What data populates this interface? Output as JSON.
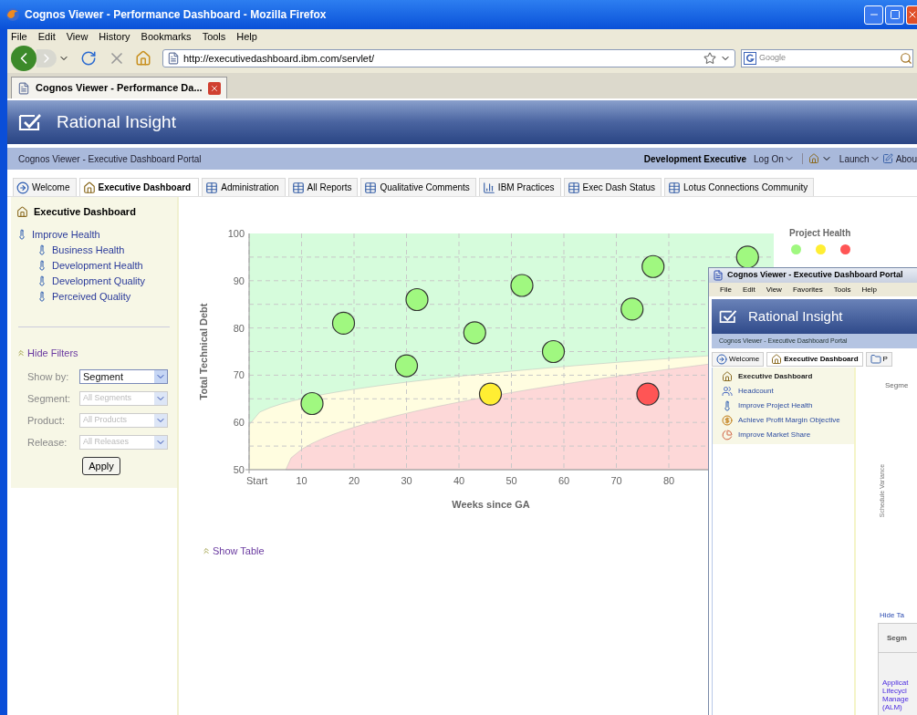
{
  "window": {
    "title": "Cognos Viewer - Performance Dashboard - Mozilla Firefox"
  },
  "menu": [
    "File",
    "Edit",
    "View",
    "History",
    "Bookmarks",
    "Tools",
    "Help"
  ],
  "address_bar": {
    "value": "http://executivedashboard.ibm.com/servlet/"
  },
  "search": {
    "placeholder": "Google"
  },
  "browser_tabs": [
    {
      "label": "Cognos Viewer - Performance Da...",
      "selected": true
    }
  ],
  "app": {
    "title": "Rational Insight"
  },
  "portal_bar": {
    "title": "Cognos Viewer - Executive Dashboard Portal",
    "user": "Development Executive",
    "log_on": "Log On",
    "launch": "Launch",
    "about": "Abou"
  },
  "tabs": [
    {
      "label": "Welcome",
      "kind": "welcome",
      "selected": false
    },
    {
      "label": "Executive Dashboard",
      "kind": "home",
      "selected": true
    },
    {
      "label": "Administration",
      "kind": "page",
      "selected": false
    },
    {
      "label": "All Reports",
      "kind": "page",
      "selected": false
    },
    {
      "label": "Qualitative Comments",
      "kind": "page",
      "selected": false
    },
    {
      "label": "IBM Practices",
      "kind": "chart",
      "selected": false
    },
    {
      "label": "Exec Dash Status",
      "kind": "page",
      "selected": false
    },
    {
      "label": "Lotus Connections Community",
      "kind": "page",
      "selected": false
    }
  ],
  "sidebar": {
    "title": "Executive Dashboard",
    "items": [
      {
        "label": "Improve Health",
        "children": [
          {
            "label": "Business Health"
          },
          {
            "label": "Development Health"
          },
          {
            "label": "Development Quality"
          },
          {
            "label": "Perceived Quality"
          }
        ]
      }
    ],
    "filters": {
      "toggle": "Hide Filters",
      "apply": "Apply",
      "fields": [
        {
          "label": "Show by:",
          "value": "Segment",
          "disabled": false
        },
        {
          "label": "Segment:",
          "value": "All Segments",
          "disabled": true
        },
        {
          "label": "Product:",
          "value": "All Products",
          "disabled": true
        },
        {
          "label": "Release:",
          "value": "All Releases",
          "disabled": true
        }
      ]
    }
  },
  "chart": {
    "legend": {
      "title": "Project Health",
      "items": [
        {
          "color": "#a0f880"
        },
        {
          "color": "#ffee33"
        },
        {
          "color": "#ff5555"
        }
      ]
    },
    "chart_data": {
      "type": "scatter",
      "xlabel": "Weeks since GA",
      "ylabel": "Total Technical Debt",
      "xlim": [
        0,
        100
      ],
      "ylim": [
        50,
        100
      ],
      "grid": true,
      "xticks": [
        {
          "value": 0,
          "label": "Start"
        },
        10,
        20,
        30,
        40,
        50,
        60,
        70,
        80
      ],
      "yticks": [
        50,
        60,
        70,
        80,
        90,
        100
      ],
      "series": [
        {
          "color": "#a0f880",
          "x": [
            12,
            18,
            30,
            32,
            43,
            52,
            58,
            73,
            77,
            95
          ],
          "values": [
            64,
            81,
            72,
            86,
            79,
            89,
            75,
            84,
            93,
            95
          ]
        },
        {
          "color": "#ffee33",
          "x": [
            46
          ],
          "values": [
            66
          ]
        },
        {
          "color": "#ff5555",
          "x": [
            76
          ],
          "values": [
            66
          ]
        }
      ]
    }
  },
  "show_table": "Show Table",
  "popup": {
    "title": "Cognos Viewer - Executive Dashboard Portal",
    "menu": [
      "File",
      "Edit",
      "View",
      "Favorites",
      "Tools",
      "Help"
    ],
    "app_title": "Rational Insight",
    "portal_title": "Cognos Viewer - Executive Dashboard Portal",
    "tabs": [
      {
        "label": "Welcome",
        "kind": "welcome",
        "selected": false
      },
      {
        "label": "Executive Dashboard",
        "kind": "home",
        "selected": true
      },
      {
        "label": "P",
        "kind": "folder",
        "selected": false
      }
    ],
    "sidebar": [
      {
        "label": "Executive Dashboard",
        "kind": "home"
      },
      {
        "label": "Headcount",
        "kind": "people"
      },
      {
        "label": "Improve Project Health",
        "kind": "thermometer"
      },
      {
        "label": "Achieve Profit Margin Objective",
        "kind": "coin"
      },
      {
        "label": "Improve Market Share",
        "kind": "pie"
      }
    ],
    "segment_label": "Segme",
    "axis_label": "Schedule Variance",
    "hide_table": "Hide Ta",
    "table": {
      "columns": [
        "Segm"
      ],
      "rows": [
        [
          "Applicat Lifecycl Manage (ALM)"
        ]
      ]
    }
  }
}
